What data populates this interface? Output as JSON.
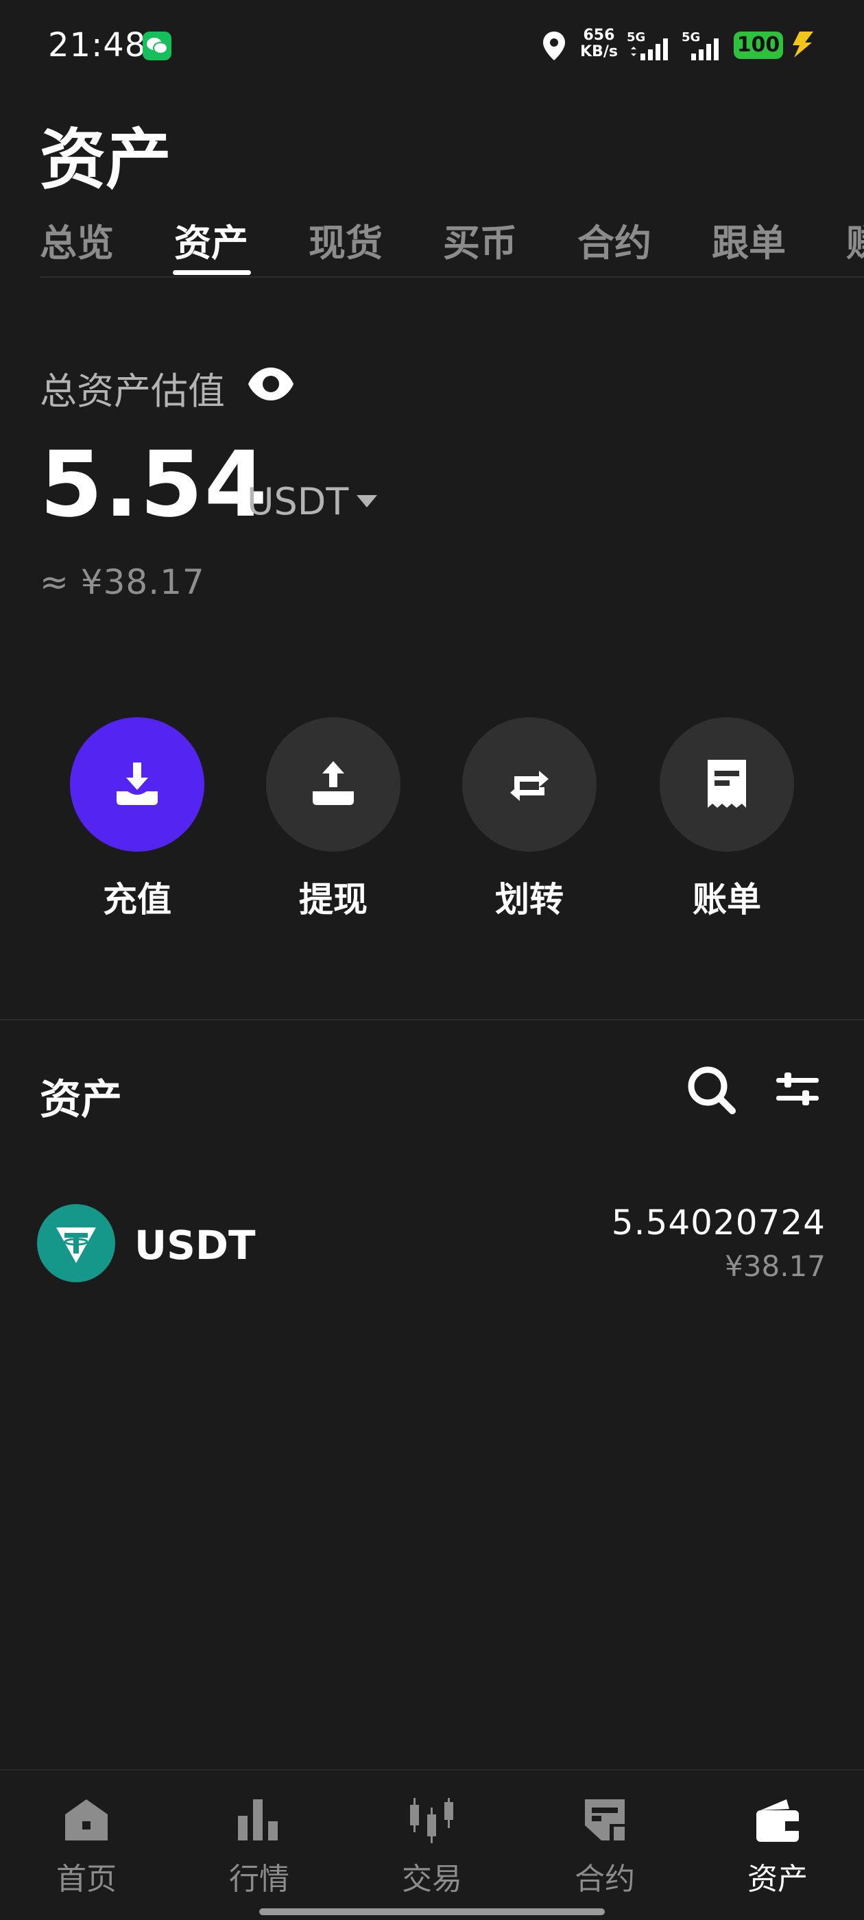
{
  "status_bar": {
    "time": "21:48",
    "speed_value": "656",
    "speed_unit": "KB/s",
    "signal_1": "5G",
    "signal_2": "5G",
    "battery": "100"
  },
  "header": {
    "title": "资产"
  },
  "tabs": [
    {
      "label": "总览"
    },
    {
      "label": "资产",
      "active": true
    },
    {
      "label": "现货"
    },
    {
      "label": "买币"
    },
    {
      "label": "合约"
    },
    {
      "label": "跟单"
    },
    {
      "label": "赚"
    }
  ],
  "summary": {
    "label": "总资产估值",
    "value": "5.54",
    "unit": "USDT",
    "cny": "≈ ¥38.17"
  },
  "actions": [
    {
      "label": "充值",
      "icon": "deposit-icon"
    },
    {
      "label": "提现",
      "icon": "withdraw-icon"
    },
    {
      "label": "划转",
      "icon": "transfer-icon"
    },
    {
      "label": "账单",
      "icon": "bill-icon"
    }
  ],
  "assets_section": {
    "title": "资产",
    "items": [
      {
        "symbol": "USDT",
        "amount": "5.54020724",
        "cny": "¥38.17"
      }
    ]
  },
  "bottom_nav": [
    {
      "label": "首页",
      "icon": "home-icon"
    },
    {
      "label": "行情",
      "icon": "market-icon"
    },
    {
      "label": "交易",
      "icon": "trade-icon"
    },
    {
      "label": "合约",
      "icon": "futures-icon"
    },
    {
      "label": "资产",
      "icon": "wallet-icon",
      "active": true
    }
  ],
  "colors": {
    "background": "#1b1b1b",
    "primary": "#5425f0",
    "usdt": "#15988a",
    "battery": "#2ec23c"
  }
}
